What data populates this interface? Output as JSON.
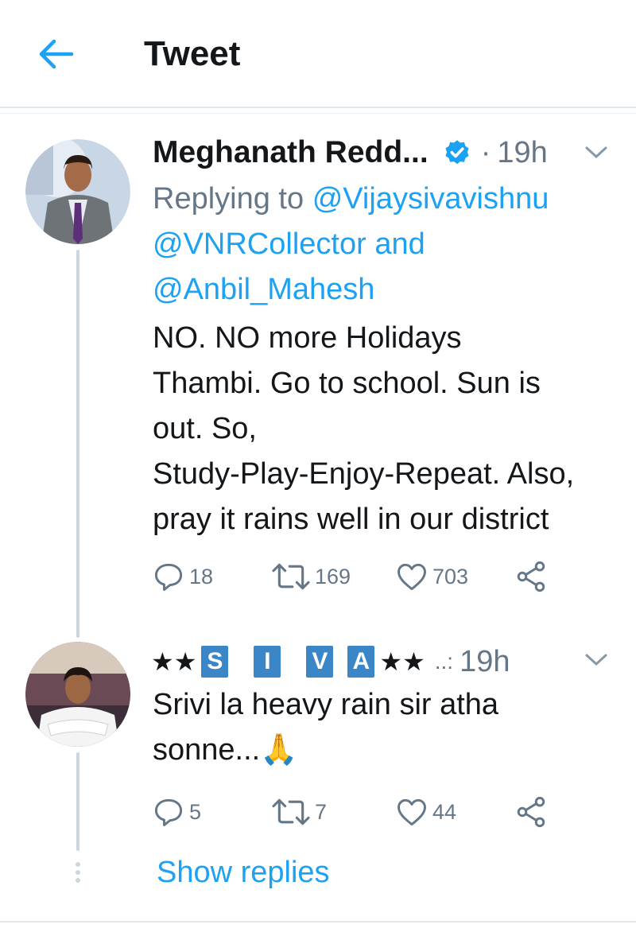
{
  "header": {
    "title": "Tweet"
  },
  "tweets": [
    {
      "author": "Meghanath Redd...",
      "time": "19h",
      "replying_prefix": "Replying to",
      "mention_1": "@Vijaysivavishnu",
      "mention_2": "@VNRCollector",
      "mention_joiner": "and",
      "mention_3": "@Anbil_Mahesh",
      "text_lines": [
        "NO. NO more Holidays",
        "Thambi. Go to school. Sun is",
        "out. So,",
        "Study-Play-Enjoy-Repeat. Also,",
        "pray it rains well in our district"
      ],
      "replies": "18",
      "retweets": "169",
      "likes": "703"
    },
    {
      "author_letters": [
        "S",
        "I",
        "V",
        "A"
      ],
      "author_stars_left": "★★",
      "author_stars_right": "★★",
      "author_suffix": "..:",
      "time": "19h",
      "text_lines": [
        "Srivi la heavy rain sir atha",
        "sonne...🙏"
      ],
      "replies": "5",
      "retweets": "7",
      "likes": "44"
    }
  ],
  "show_replies": "Show replies",
  "colors": {
    "accent": "#1da1f2",
    "verified": "#1da1f2",
    "secondary_text": "#657786",
    "divider": "#e1e8ed",
    "siva_box": "#3a86c6"
  },
  "icons": [
    "back-arrow-icon",
    "verified-badge-icon",
    "chevron-down-icon",
    "reply-icon",
    "retweet-icon",
    "like-icon",
    "share-icon"
  ]
}
